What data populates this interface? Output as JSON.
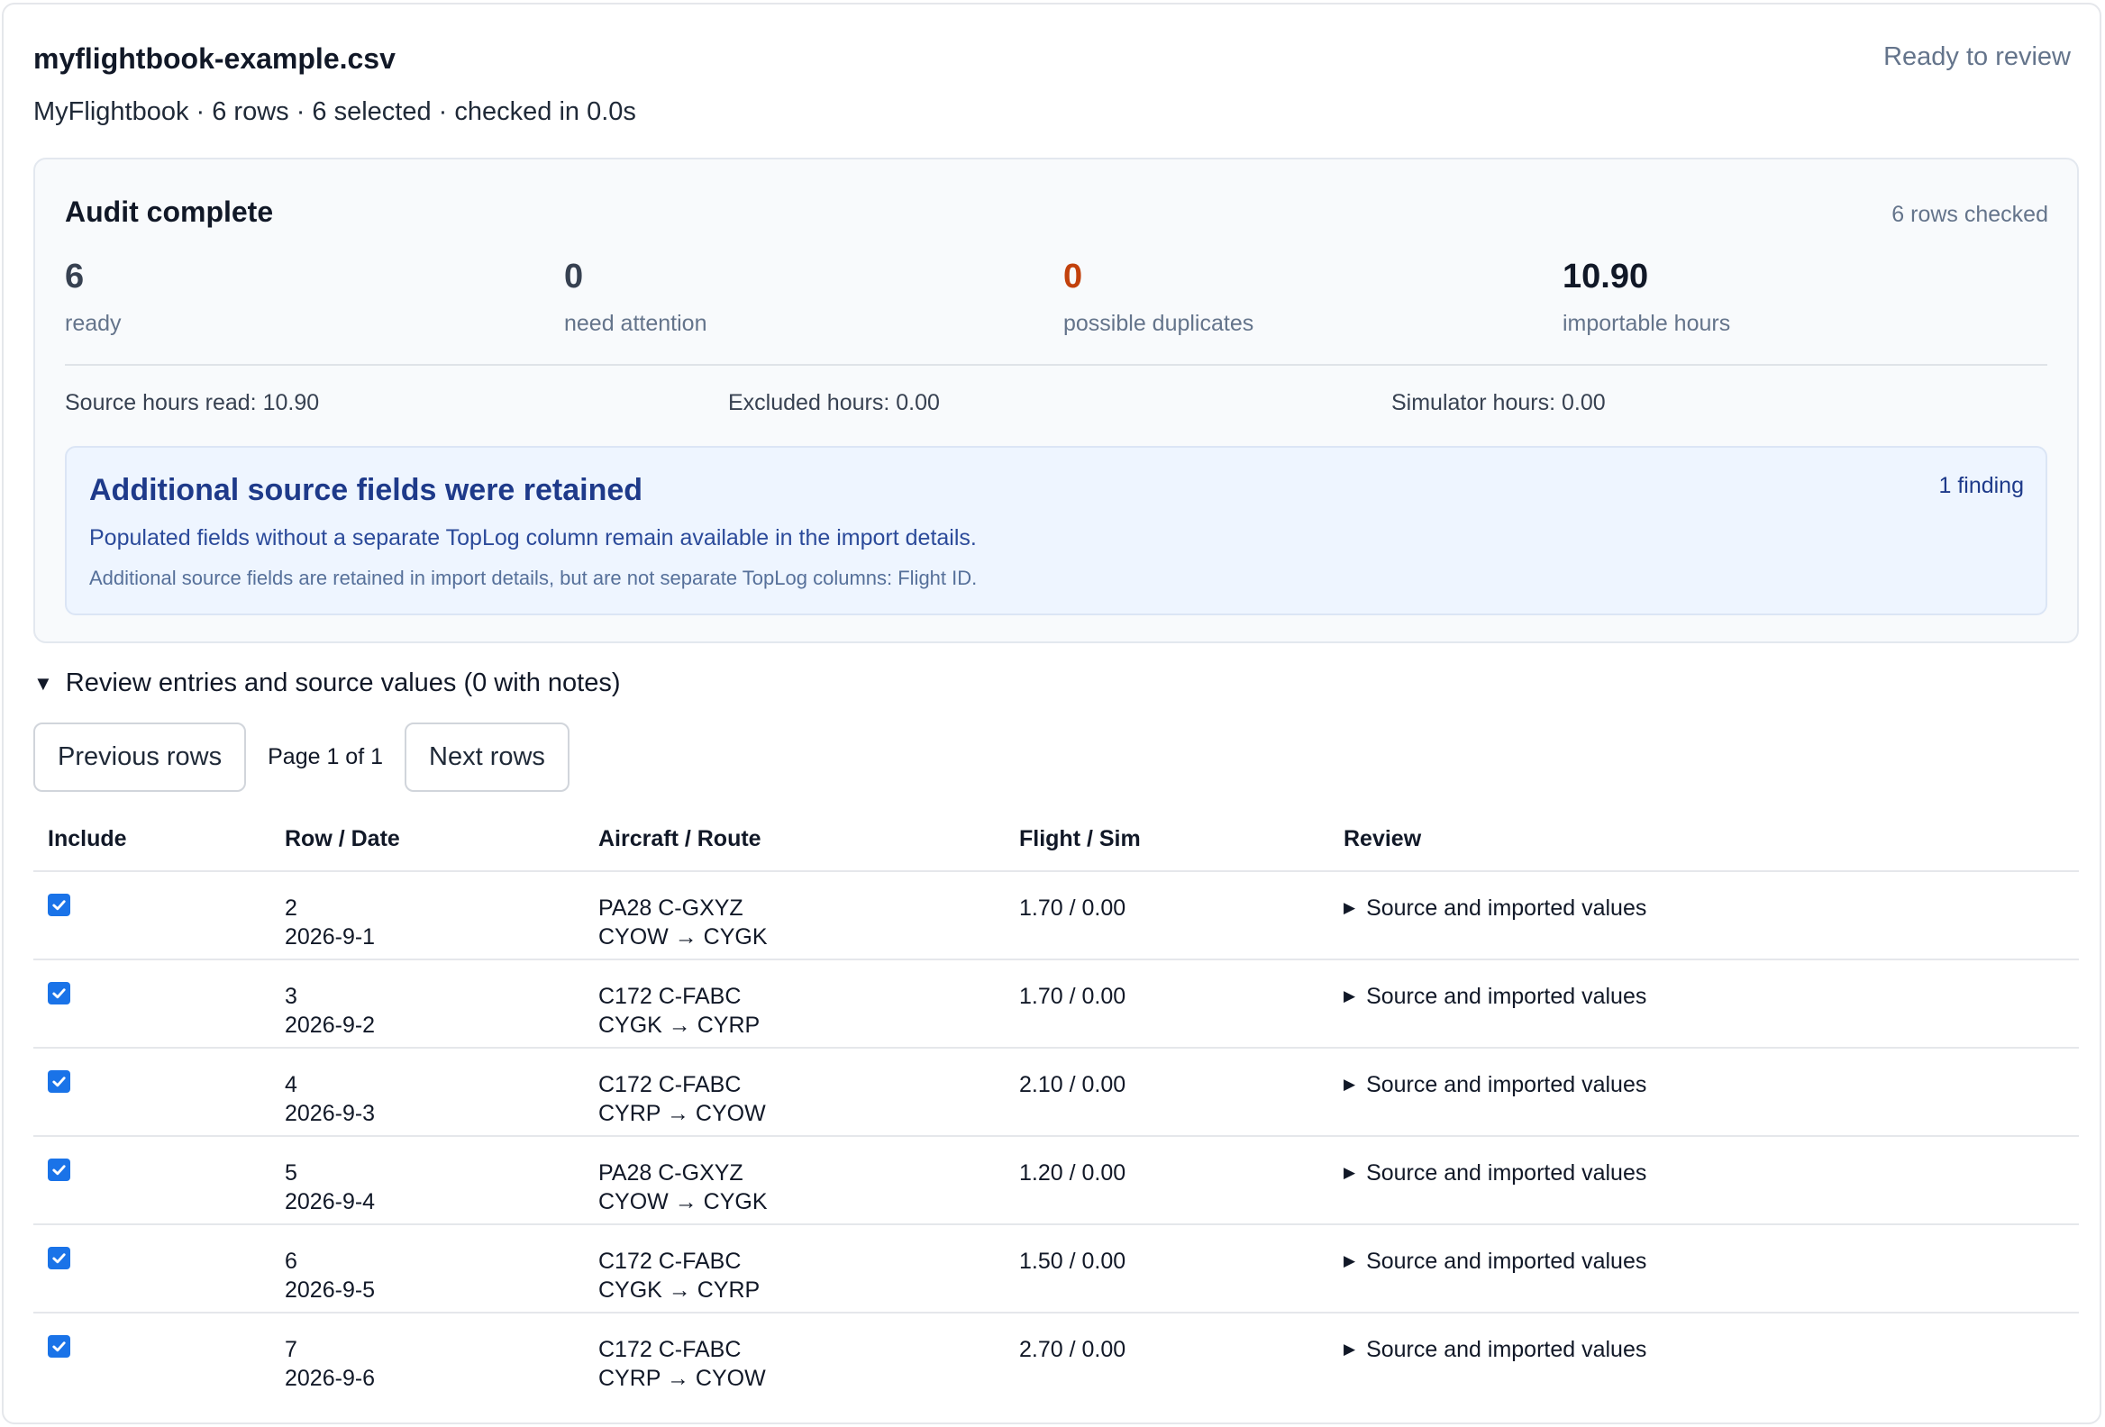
{
  "file": {
    "title": "myflightbook-example.csv",
    "status": "Ready to review",
    "meta": "MyFlightbook · 6 rows · 6 selected · checked in 0.0s"
  },
  "audit": {
    "title": "Audit complete",
    "rows_checked": "6 rows checked",
    "stats": [
      {
        "value": "6",
        "label": "ready"
      },
      {
        "value": "0",
        "label": "need attention"
      },
      {
        "value": "0",
        "label": "possible duplicates"
      },
      {
        "value": "10.90",
        "label": "importable hours"
      }
    ],
    "hours": {
      "source": "Source hours read: 10.90",
      "excluded": "Excluded hours: 0.00",
      "simulator": "Simulator hours: 0.00"
    },
    "finding": {
      "title": "Additional source fields were retained",
      "count": "1 finding",
      "description": "Populated fields without a separate TopLog column remain available in the import details.",
      "detail": "Additional source fields are retained in import details, but are not separate TopLog columns: Flight ID."
    }
  },
  "review": {
    "summary": "Review entries and source values (0 with notes)",
    "previous_label": "Previous rows",
    "page_label": "Page 1 of 1",
    "next_label": "Next rows"
  },
  "table": {
    "headers": [
      "Include",
      "Row / Date",
      "Aircraft / Route",
      "Flight / Sim",
      "Review"
    ],
    "rows": [
      {
        "row": "2",
        "date": "2026-9-1",
        "aircraft": "PA28 C-GXYZ",
        "route": "CYOW → CYGK",
        "times": "1.70 / 0.00",
        "review": "Source and imported values"
      },
      {
        "row": "3",
        "date": "2026-9-2",
        "aircraft": "C172 C-FABC",
        "route": "CYGK → CYRP",
        "times": "1.70 / 0.00",
        "review": "Source and imported values"
      },
      {
        "row": "4",
        "date": "2026-9-3",
        "aircraft": "C172 C-FABC",
        "route": "CYRP → CYOW",
        "times": "2.10 / 0.00",
        "review": "Source and imported values"
      },
      {
        "row": "5",
        "date": "2026-9-4",
        "aircraft": "PA28 C-GXYZ",
        "route": "CYOW → CYGK",
        "times": "1.20 / 0.00",
        "review": "Source and imported values"
      },
      {
        "row": "6",
        "date": "2026-9-5",
        "aircraft": "C172 C-FABC",
        "route": "CYGK → CYRP",
        "times": "1.50 / 0.00",
        "review": "Source and imported values"
      },
      {
        "row": "7",
        "date": "2026-9-6",
        "aircraft": "C172 C-FABC",
        "route": "CYRP → CYOW",
        "times": "2.70 / 0.00",
        "review": "Source and imported values"
      }
    ]
  },
  "colors": {
    "accent": "#1a73e8",
    "warning": "#c2410c",
    "finding_title": "#1e3a8a",
    "finding_bg": "#eef5ff"
  }
}
